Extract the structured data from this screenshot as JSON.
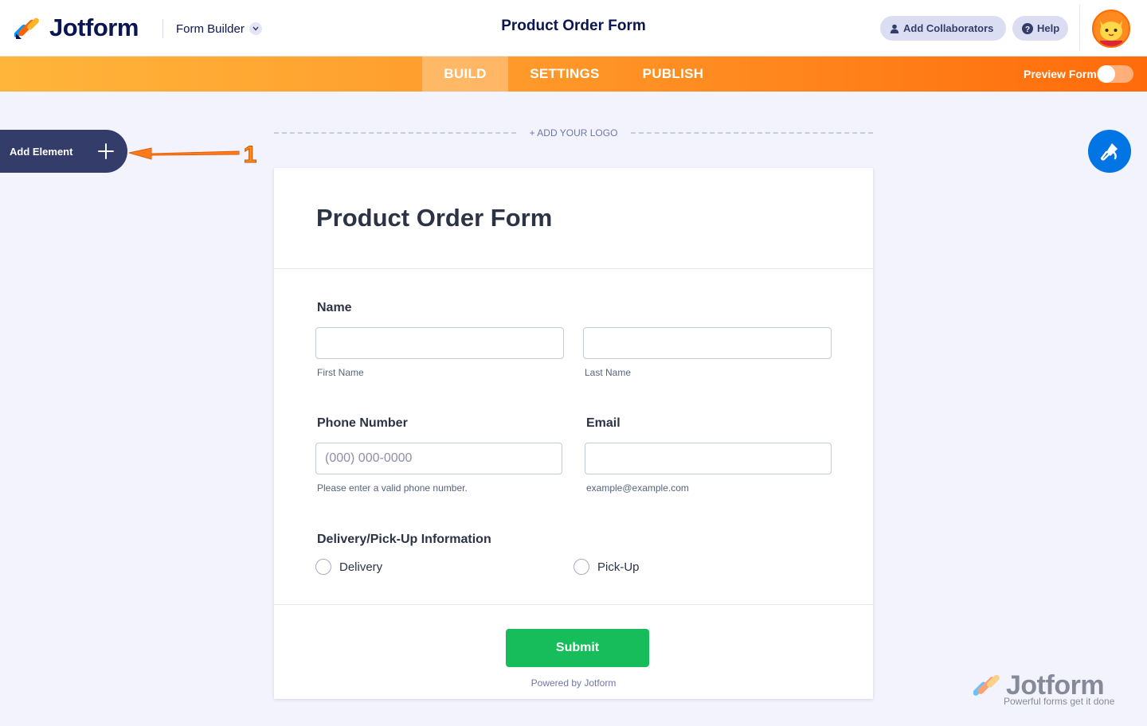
{
  "header": {
    "brand": "Jotform",
    "builder_label": "Form Builder",
    "form_title": "Product Order Form",
    "collaborators_label": "Add Collaborators",
    "help_label": "Help"
  },
  "nav": {
    "tabs": [
      {
        "label": "BUILD",
        "active": true
      },
      {
        "label": "SETTINGS",
        "active": false
      },
      {
        "label": "PUBLISH",
        "active": false
      }
    ],
    "preview_label": "Preview Form",
    "preview_on": false
  },
  "sidebar": {
    "add_element_label": "Add Element",
    "annotation_number": "1"
  },
  "canvas": {
    "add_logo_label": "+ ADD YOUR LOGO"
  },
  "form": {
    "title": "Product Order Form",
    "name": {
      "label": "Name",
      "first_value": "",
      "first_sublabel": "First Name",
      "last_value": "",
      "last_sublabel": "Last Name"
    },
    "phone": {
      "label": "Phone Number",
      "placeholder": "(000) 000-0000",
      "sublabel": "Please enter a valid phone number."
    },
    "email": {
      "label": "Email",
      "value": "",
      "sublabel": "example@example.com"
    },
    "delivery": {
      "label": "Delivery/Pick-Up Information",
      "options": [
        "Delivery",
        "Pick-Up"
      ]
    },
    "submit_label": "Submit",
    "powered_by": "Powered by Jotform"
  },
  "watermark": {
    "brand": "Jotform",
    "tagline": "Powerful forms get it done"
  },
  "colors": {
    "brand_navy": "#0a1551",
    "orange": "#ff6b0a",
    "submit_green": "#18bd5b",
    "designer_blue": "#0075e3"
  }
}
